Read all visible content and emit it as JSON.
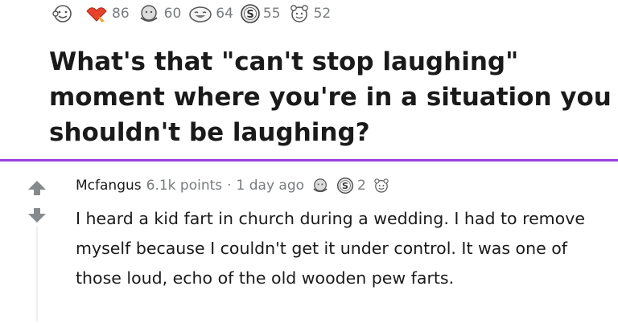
{
  "post": {
    "awards": [
      {
        "icon": "wholesome-award-icon",
        "count": "86"
      },
      {
        "icon": "helpful-award-icon",
        "count": "60"
      },
      {
        "icon": "hugz-award-icon",
        "count": "64"
      },
      {
        "icon": "silver-award-icon",
        "count": "55"
      },
      {
        "icon": "bless-up-award-icon",
        "count": "52"
      }
    ],
    "title": "What's that \"can't stop laughing\" moment where you're in a situation you shouldn't be laughing?"
  },
  "comment": {
    "username": "Mcfangus",
    "points": "6.1k points",
    "separator": "·",
    "time": "1 day ago",
    "awards": [
      {
        "icon": "hugz-award-icon"
      },
      {
        "icon": "silver-award-icon",
        "count": "2"
      },
      {
        "icon": "bless-up-award-icon"
      }
    ],
    "body": "I heard a kid fart in church during a wedding. I had to remove myself because I couldn't get it under control. It was one of those loud, echo of the old wooden pew farts."
  },
  "colors": {
    "divider": "#9b3fdc",
    "meta_text": "#787c7e",
    "vote_arrow": "#878a8c"
  }
}
